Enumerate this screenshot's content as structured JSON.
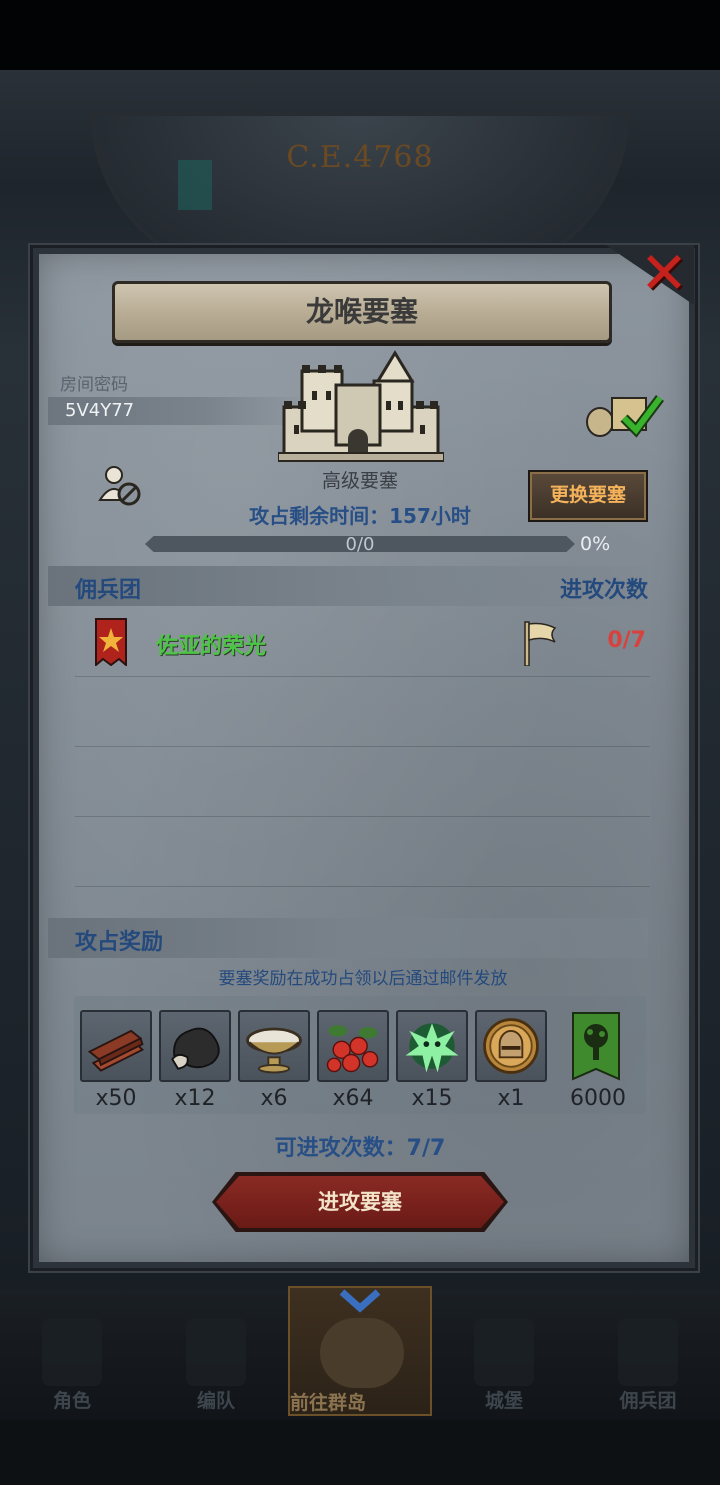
{
  "background": {
    "era": "C.E.4768"
  },
  "dialog": {
    "title": "龙喉要塞",
    "room_code_label": "房间密码",
    "room_code": "5V4Y77",
    "fortress_level": "高级要塞",
    "change_button": "更换要塞",
    "time_remaining": "攻占剩余时间：157小时",
    "progress": {
      "text": "0/0",
      "percent_text": "0%",
      "fraction": 0
    },
    "mercenary_header": "佣兵团",
    "attack_count_header": "进攻次数",
    "mercenaries": [
      {
        "name": "佐亚的荣光",
        "attacks": "0/7"
      }
    ],
    "reward_header": "攻占奖励",
    "reward_note": "要塞奖励在成功占领以后通过邮件发放",
    "rewards": [
      {
        "icon": "wood-planks-icon",
        "qty": "x50"
      },
      {
        "icon": "ore-rock-icon",
        "qty": "x12"
      },
      {
        "icon": "milk-bowl-icon",
        "qty": "x6"
      },
      {
        "icon": "berries-icon",
        "qty": "x64"
      },
      {
        "icon": "green-spirit-icon",
        "qty": "x15"
      },
      {
        "icon": "knight-helmet-coin-icon",
        "qty": "x1"
      },
      {
        "icon": "tree-banner-icon",
        "qty": "6000"
      }
    ],
    "attempts_text": "可进攻次数：7/7",
    "attack_button": "进攻要塞"
  },
  "nav": {
    "items": [
      {
        "label": "角色",
        "icon": "knight-icon"
      },
      {
        "label": "编队",
        "icon": "helmet-icon"
      },
      {
        "label": "前往群岛",
        "icon": "compass-icon",
        "active": true
      },
      {
        "label": "城堡",
        "icon": "castle-icon"
      },
      {
        "label": "佣兵团",
        "icon": "mercenary-icon"
      }
    ]
  },
  "colors": {
    "accent_blue": "#274f86",
    "merc_green": "#4ec447",
    "count_red": "#d8423e",
    "close_red": "#c5221d",
    "button_gold": "#f4b25a",
    "attack_button": "#7a221d"
  }
}
